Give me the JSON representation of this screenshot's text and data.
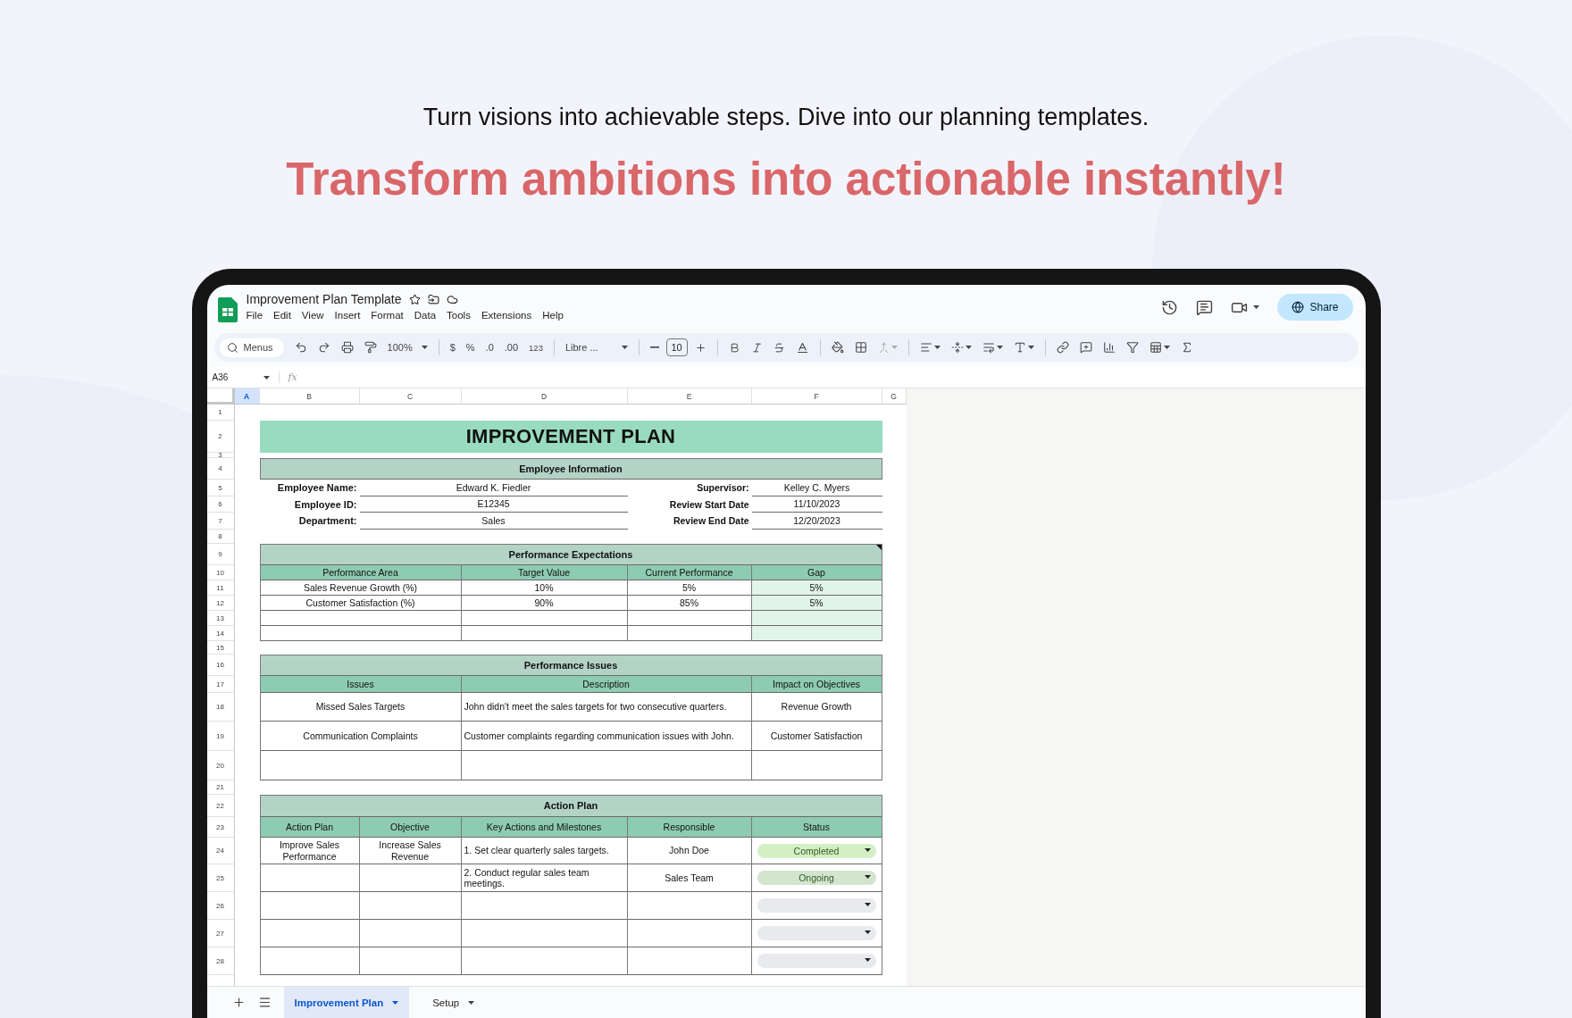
{
  "page": {
    "tagline": "Turn visions into achievable steps. Dive into our planning templates.",
    "headline": "Transform ambitions into actionable instantly!"
  },
  "app": {
    "title": "Improvement Plan Template",
    "menus": [
      "File",
      "Edit",
      "View",
      "Insert",
      "Format",
      "Data",
      "Tools",
      "Extensions",
      "Help"
    ],
    "share": "Share"
  },
  "toolbar": {
    "search": "Menus",
    "zoom": "100%",
    "currency": "$",
    "percent": "%",
    "decrease_decimal": ".0",
    "increase_decimal": ".00",
    "number_format": "123",
    "font": "Libre ...",
    "font_size": "10"
  },
  "formula_bar": {
    "cell": "A36",
    "function_label": "fx"
  },
  "sheet": {
    "columns": [
      {
        "label": "A",
        "selected": true
      },
      {
        "label": "B",
        "selected": false
      },
      {
        "label": "C",
        "selected": false
      },
      {
        "label": "D",
        "selected": false
      },
      {
        "label": "E",
        "selected": false
      },
      {
        "label": "F",
        "selected": false
      },
      {
        "label": "G",
        "selected": false
      }
    ],
    "rows": [
      "1",
      "2",
      "3",
      "4",
      "5",
      "6",
      "7",
      "8",
      "9",
      "10",
      "11",
      "12",
      "13",
      "14",
      "15",
      "16",
      "17",
      "18",
      "19",
      "20",
      "21",
      "22",
      "23",
      "24",
      "25",
      "26",
      "27",
      "28"
    ]
  },
  "title": "IMPROVEMENT PLAN",
  "employee_info": {
    "heading": "Employee Information",
    "left": [
      {
        "label": "Employee Name:",
        "value": "Edward K. Fiedler"
      },
      {
        "label": "Employee ID:",
        "value": "E12345"
      },
      {
        "label": "Department:",
        "value": "Sales"
      }
    ],
    "right": [
      {
        "label": "Supervisor:",
        "value": "Kelley C. Myers"
      },
      {
        "label": "Review Start Date",
        "value": "11/10/2023"
      },
      {
        "label": "Review End Date",
        "value": "12/20/2023"
      }
    ]
  },
  "expectations": {
    "heading": "Performance Expectations",
    "columns": [
      "Performance Area",
      "Target Value",
      "Current Performance",
      "Gap"
    ],
    "rows": [
      [
        "Sales Revenue Growth (%)",
        "10%",
        "5%",
        "5%"
      ],
      [
        "Customer Satisfaction (%)",
        "90%",
        "85%",
        "5%"
      ]
    ]
  },
  "issues": {
    "heading": "Performance Issues",
    "columns": [
      "Issues",
      "Description",
      "Impact on Objectives"
    ],
    "rows": [
      [
        "Missed Sales Targets",
        "John didn't meet the sales targets for two consecutive quarters.",
        "Revenue Growth"
      ],
      [
        "Communication Complaints",
        "Customer complaints regarding communication issues with John.",
        "Customer Satisfaction"
      ]
    ]
  },
  "action_plan": {
    "heading": "Action Plan",
    "columns": [
      "Action Plan",
      "Objective",
      "Key Actions and Milestones",
      "Responsible",
      "Status"
    ],
    "rows": [
      {
        "cells": [
          "Improve Sales Performance",
          "Increase Sales Revenue",
          "1. Set clear quarterly sales targets.",
          "John Doe"
        ],
        "status": {
          "label": "Completed",
          "color": "#d4efc4"
        }
      },
      {
        "cells": [
          null,
          null,
          "2. Conduct regular sales team meetings.",
          "Sales Team"
        ],
        "status": {
          "label": "Ongoing",
          "color": "#d3e5cf"
        }
      }
    ]
  },
  "sheet_tabs": [
    {
      "label": "Improvement Plan",
      "selected": true
    },
    {
      "label": "Setup",
      "selected": false
    }
  ]
}
